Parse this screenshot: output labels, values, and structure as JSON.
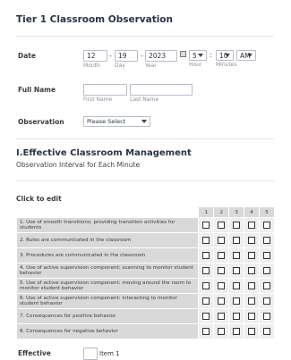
{
  "form": {
    "title": "Tier 1 Classroom Observation"
  },
  "date_field": {
    "label": "Date",
    "month": "12",
    "day": "19",
    "year": "2023",
    "month_sub": "Month",
    "day_sub": "Day",
    "year_sub": "Year",
    "hour": "5",
    "minute": "10",
    "ampm": "AM",
    "hour_sub": "Hour",
    "minute_sub": "Minutes",
    "separator_dash": "-",
    "separator_colon": ":"
  },
  "full_name": {
    "label": "Full Name",
    "first_sub": "First Name",
    "last_sub": "Last Name",
    "first_value": "",
    "last_value": ""
  },
  "observation": {
    "label": "Observation",
    "selected": "Please Select"
  },
  "section": {
    "title": "I.Effective Classroom Management",
    "subtitle": "Observation Interval for Each Minute"
  },
  "matrix": {
    "label": "Click to edit",
    "columns": [
      "1",
      "2",
      "3",
      "4",
      "5"
    ],
    "rows": [
      "1. Use of smooth transitions: providing transition activities for students",
      "2. Rules are communicated in the classroom",
      "3. Procedures are communicated in the classroom",
      "4. Use of active supervision component: scanning to monitor student behavior",
      "5. Use of active supervision component: moving around the room to monitor student behavior",
      "6. Use of active supervision component: interacting to monitor student behavior",
      "7. Consequences for positive behavior",
      "8. Consequences for negative behavior"
    ]
  },
  "effective": {
    "label": "Effective",
    "item1": "Item 1"
  },
  "icons": {
    "calendar": "calendar-icon",
    "dropdown": "chevron-down-icon"
  }
}
